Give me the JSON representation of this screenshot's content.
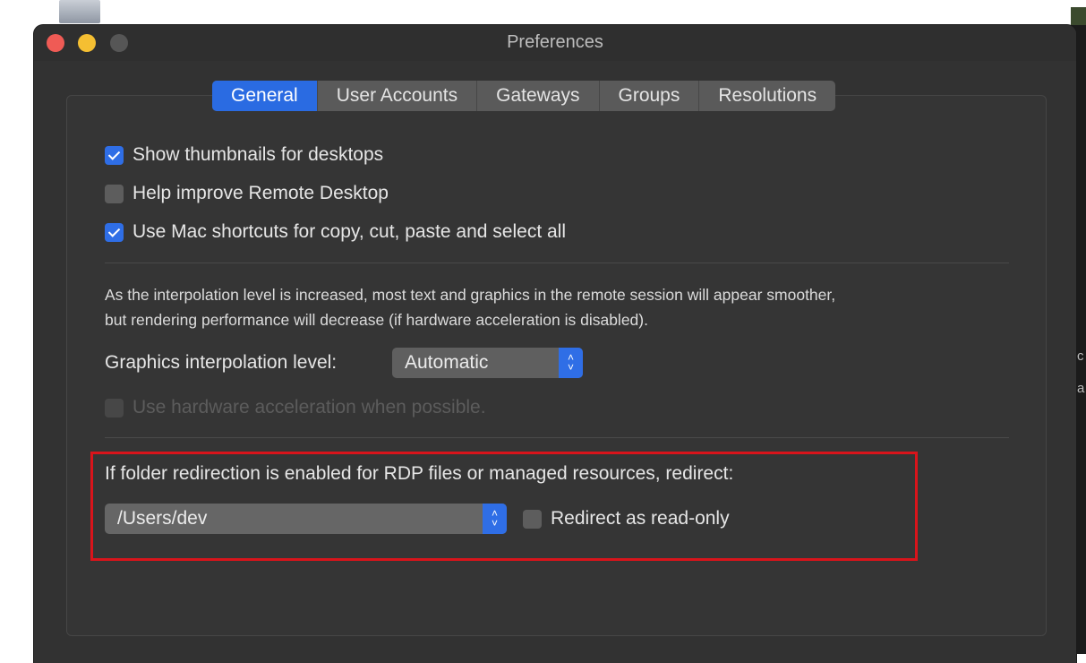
{
  "window": {
    "title": "Preferences"
  },
  "tabs": [
    {
      "label": "General",
      "active": true
    },
    {
      "label": "User Accounts",
      "active": false
    },
    {
      "label": "Gateways",
      "active": false
    },
    {
      "label": "Groups",
      "active": false
    },
    {
      "label": "Resolutions",
      "active": false
    }
  ],
  "general": {
    "show_thumbnails": {
      "label": "Show thumbnails for desktops",
      "checked": true
    },
    "help_improve": {
      "label": "Help improve Remote Desktop",
      "checked": false
    },
    "mac_shortcuts": {
      "label": "Use Mac shortcuts for copy, cut, paste and select all",
      "checked": true
    },
    "interpolation_note_line1": "As the interpolation level is increased, most text and graphics in the remote session will appear smoother,",
    "interpolation_note_line2": "but rendering performance will decrease (if hardware acceleration is disabled).",
    "interpolation_label": "Graphics interpolation level:",
    "interpolation_value": "Automatic",
    "hardware_accel": {
      "label": "Use hardware acceleration when possible.",
      "checked": false,
      "disabled": true
    },
    "folder_redirect_label": "If folder redirection is enabled for RDP files or managed resources, redirect:",
    "folder_path_value": "/Users/dev",
    "read_only": {
      "label": "Redirect as read-only",
      "checked": false
    }
  },
  "colors": {
    "accent": "#2f6ee6",
    "highlight_box": "#d9141b",
    "window_bg": "#323232"
  },
  "background_glyphs": [
    "c",
    "a"
  ]
}
